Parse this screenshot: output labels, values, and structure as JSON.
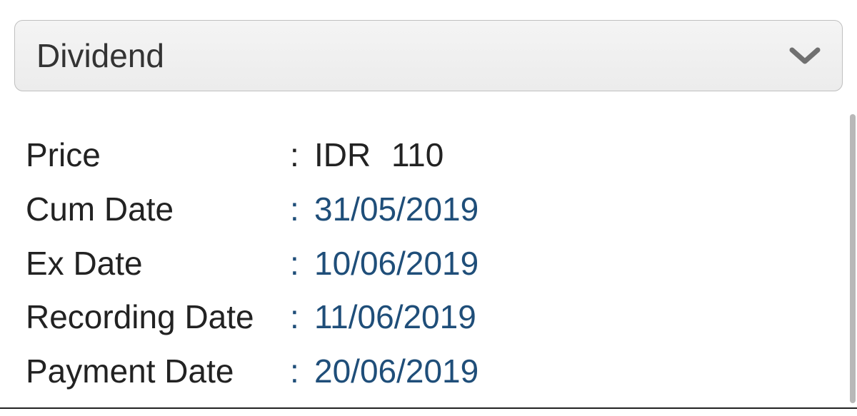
{
  "dropdown": {
    "selected_label": "Dividend"
  },
  "details": {
    "price": {
      "label": "Price",
      "currency": "IDR",
      "amount": "110"
    },
    "cum_date": {
      "label": "Cum Date",
      "value": "31/05/2019"
    },
    "ex_date": {
      "label": "Ex Date",
      "value": "10/06/2019"
    },
    "recording_date": {
      "label": "Recording Date",
      "value": "11/06/2019"
    },
    "payment_date": {
      "label": "Payment Date",
      "value": "20/06/2019"
    }
  }
}
